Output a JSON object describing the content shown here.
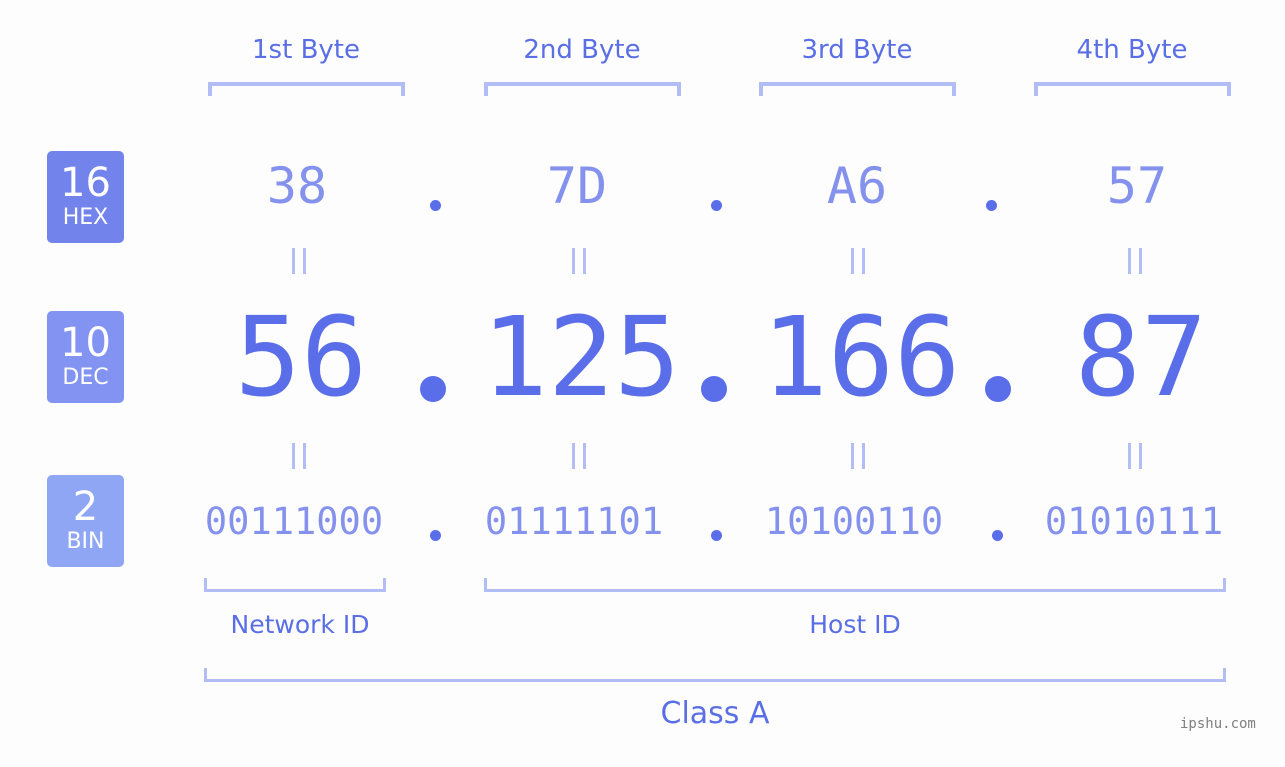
{
  "headers": [
    "1st Byte",
    "2nd Byte",
    "3rd Byte",
    "4th Byte"
  ],
  "badges": {
    "hex": {
      "number": "16",
      "label": "HEX",
      "color": "#7383ec"
    },
    "dec": {
      "number": "10",
      "label": "DEC",
      "color": "#8293f1"
    },
    "bin": {
      "number": "2",
      "label": "BIN",
      "color": "#8fa6f5"
    }
  },
  "hex": [
    "38",
    "7D",
    "A6",
    "57"
  ],
  "dec": [
    "56",
    "125",
    "166",
    "87"
  ],
  "bin": [
    "00111000",
    "01111101",
    "10100110",
    "01010111"
  ],
  "segments": {
    "network": "Network ID",
    "host": "Host ID",
    "class": "Class A"
  },
  "watermark": "ipshu.com",
  "colors": {
    "accent": "#5a6ee9",
    "light_accent": "#8492ee",
    "bracket": "#b2bdf6",
    "background": "#fcfdfc"
  }
}
